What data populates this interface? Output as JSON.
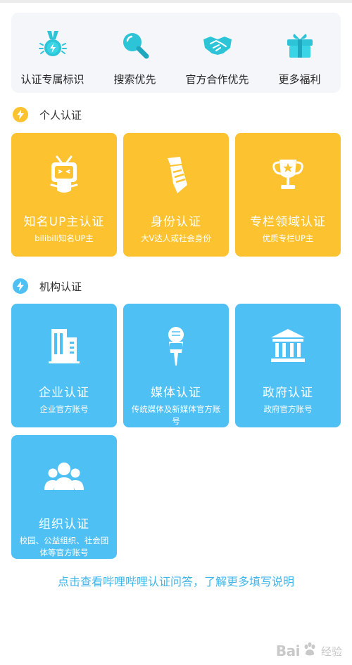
{
  "benefits": [
    {
      "label": "认证专属标识",
      "icon": "badge-medal-icon"
    },
    {
      "label": "搜索优先",
      "icon": "magnifier-icon"
    },
    {
      "label": "官方合作优先",
      "icon": "handshake-icon"
    },
    {
      "label": "更多福利",
      "icon": "gift-icon"
    }
  ],
  "personal": {
    "title": "个人认证",
    "cards": [
      {
        "title": "知名UP主认证",
        "subtitle": "bilibili知名UP主",
        "icon": "tv-mascot-icon"
      },
      {
        "title": "身份认证",
        "subtitle": "大V达人或社会身份",
        "icon": "necktie-icon"
      },
      {
        "title": "专栏领域认证",
        "subtitle": "优质专栏UP主",
        "icon": "trophy-icon"
      }
    ]
  },
  "organization": {
    "title": "机构认证",
    "cards": [
      {
        "title": "企业认证",
        "subtitle": "企业官方账号",
        "icon": "office-building-icon"
      },
      {
        "title": "媒体认证",
        "subtitle": "传统媒体及新媒体官方账号",
        "icon": "microphone-new-icon"
      },
      {
        "title": "政府认证",
        "subtitle": "政府官方账号",
        "icon": "government-building-icon"
      },
      {
        "title": "组织认证",
        "subtitle": "校园、公益组织、社会团体等官方账号",
        "icon": "group-people-icon"
      }
    ]
  },
  "footer": {
    "link": "点击查看哔哩哔哩认证问答，了解更多填写说明"
  },
  "watermark": {
    "text_left": "Bai",
    "text_right": "经验"
  },
  "colors": {
    "yellow_card": "#fdc22f",
    "blue_card": "#4ec0f4",
    "link": "#3fb5ec",
    "benefit_panel": "#f4f6fa"
  }
}
